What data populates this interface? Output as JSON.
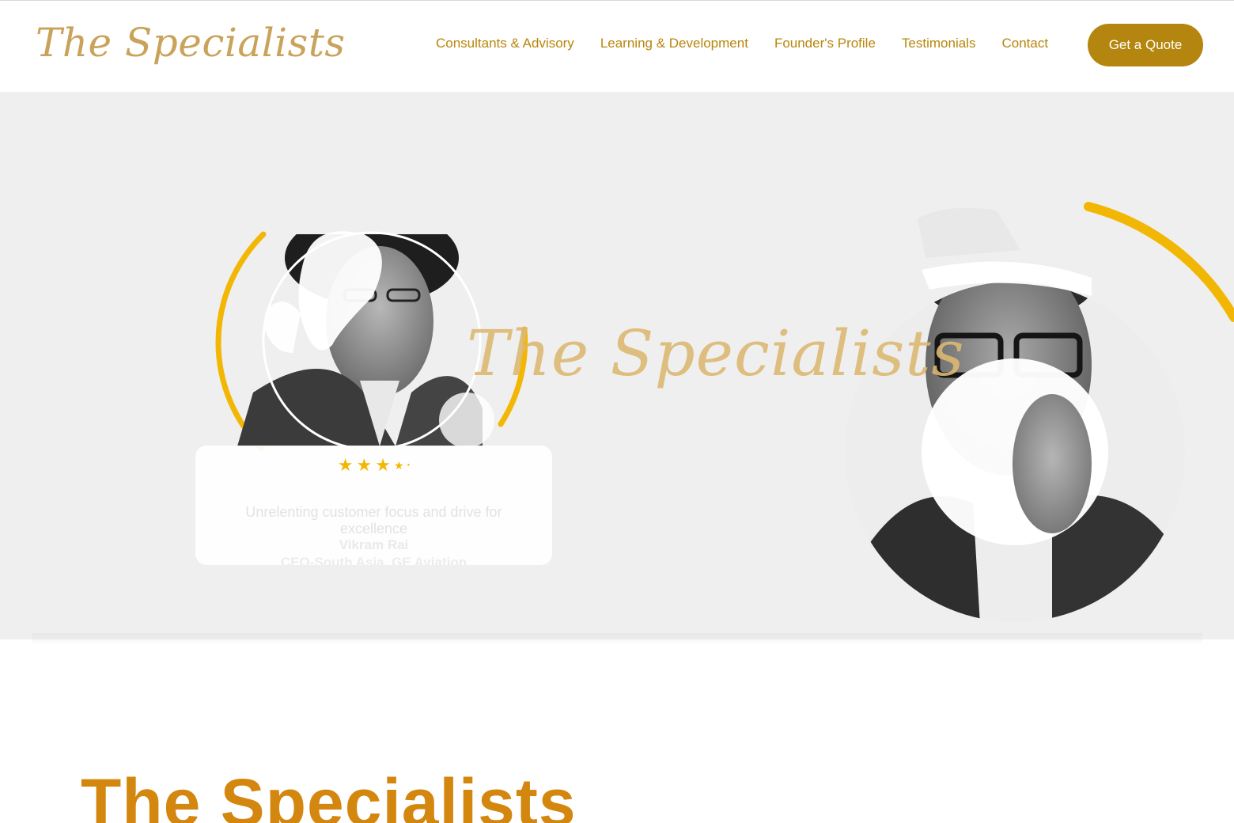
{
  "header": {
    "logo_text": "The Specialists",
    "nav": [
      {
        "label": "Consultants & Advisory"
      },
      {
        "label": "Learning & Development"
      },
      {
        "label": "Founder's Profile"
      },
      {
        "label": "Testimonials"
      },
      {
        "label": "Contact"
      }
    ],
    "cta_label": "Get a Quote"
  },
  "hero": {
    "center_logo_text": "The Specialists",
    "testimonial": {
      "rating_stars": 3.5,
      "rating_max": 5,
      "quote": "Unrelenting customer focus and drive for excellence",
      "author": "Vikram Rai",
      "role": "CEO-South Asia, GE Aviation"
    }
  },
  "section": {
    "title": "The Specialists"
  },
  "colors": {
    "brand_gold": "#b5860f",
    "nav_text": "#b8860b",
    "accent_yellow": "#f2b705",
    "hero_bg": "#efefef",
    "section_title": "#d4870e"
  }
}
